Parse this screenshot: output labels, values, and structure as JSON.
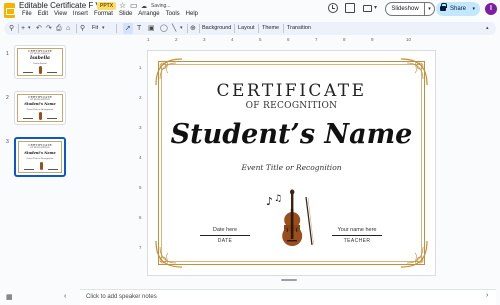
{
  "app": {
    "doc_title": "Editable Certificate F Violin",
    "file_badge": "PPTX",
    "saving_text": "Saving...",
    "avatar_letter": "I"
  },
  "menu": [
    "File",
    "Edit",
    "View",
    "Insert",
    "Format",
    "Slide",
    "Arrange",
    "Tools",
    "Help"
  ],
  "header_buttons": {
    "slideshow_label": "Slideshow",
    "share_label": "Share"
  },
  "toolbar": {
    "zoom_label": "Fit",
    "background_label": "Background",
    "layout_label": "Layout",
    "theme_label": "Theme",
    "transition_label": "Transition"
  },
  "ruler": {
    "top_ticks": [
      "1",
      "2",
      "3",
      "4",
      "5",
      "6",
      "7",
      "8",
      "9",
      "10"
    ],
    "side_ticks": [
      "1",
      "2",
      "3",
      "4",
      "5",
      "6",
      "7"
    ]
  },
  "slides_panel": [
    {
      "number": "1",
      "title": "CERTIFICATE",
      "subtitle": "OF RECOGNITION",
      "name": "Isabella",
      "event": "Violin Recital",
      "active": false
    },
    {
      "number": "2",
      "title": "CERTIFICATE",
      "subtitle": "OF RECOGNITION",
      "name": "Student's Name",
      "event": "Event Title or Recognition",
      "active": false
    },
    {
      "number": "3",
      "title": "CERTIFICATE",
      "subtitle": "OF RECOGNITION",
      "name": "Student's Name",
      "event": "Event Title or Recognition",
      "active": true
    }
  ],
  "slide": {
    "title": "CERTIFICATE",
    "subtitle": "OF RECOGNITION",
    "student_name": "Student’s Name",
    "event_title": "Event Title or Recognition",
    "left_sig_label": "Date here",
    "left_sig_caption": "DATE",
    "right_sig_label": "Your name here",
    "right_sig_caption": "TEACHER",
    "border_color": "#c28f3c",
    "violin_color": "#9a4e1d"
  },
  "notes": {
    "placeholder": "Click to add speaker notes"
  }
}
